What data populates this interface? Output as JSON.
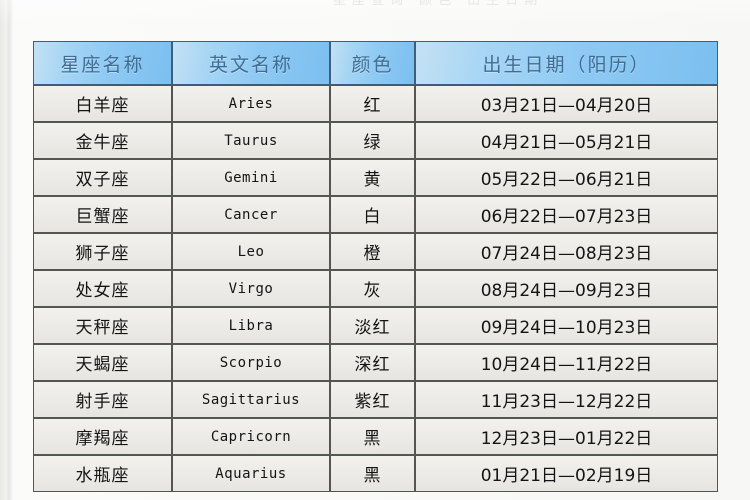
{
  "page": {
    "top_faint_text": "星座查询 颜色 出生日期",
    "background_color": "#faf9f7"
  },
  "table": {
    "header_bg_color": "#8ec9f3",
    "header_text_color": "#3f6d93",
    "cell_bg_color": "#ecebe7",
    "border_color": "#565651",
    "columns": [
      {
        "key": "name",
        "label": "星座名称"
      },
      {
        "key": "en",
        "label": "英文名称"
      },
      {
        "key": "color",
        "label": "颜色"
      },
      {
        "key": "date",
        "label": "出生日期（阳历）"
      }
    ],
    "rows": [
      {
        "name": "白羊座",
        "en": "Aries",
        "color": "红",
        "date": "03月21日—04月20日"
      },
      {
        "name": "金牛座",
        "en": "Taurus",
        "color": "绿",
        "date": "04月21日—05月21日"
      },
      {
        "name": "双子座",
        "en": "Gemini",
        "color": "黄",
        "date": "05月22日—06月21日"
      },
      {
        "name": "巨蟹座",
        "en": "Cancer",
        "color": "白",
        "date": "06月22日—07月23日"
      },
      {
        "name": "狮子座",
        "en": "Leo",
        "color": "橙",
        "date": "07月24日—08月23日"
      },
      {
        "name": "处女座",
        "en": "Virgo",
        "color": "灰",
        "date": "08月24日—09月23日"
      },
      {
        "name": "天秤座",
        "en": "Libra",
        "color": "淡红",
        "date": "09月24日—10月23日"
      },
      {
        "name": "天蝎座",
        "en": "Scorpio",
        "color": "深红",
        "date": "10月24日—11月22日"
      },
      {
        "name": "射手座",
        "en": "Sagittarius",
        "color": "紫红",
        "date": "11月23日—12月22日"
      },
      {
        "name": "摩羯座",
        "en": "Capricorn",
        "color": "黑",
        "date": "12月23日—01月22日"
      },
      {
        "name": "水瓶座",
        "en": "Aquarius",
        "color": "黑",
        "date": "01月21日—02月19日"
      }
    ]
  }
}
